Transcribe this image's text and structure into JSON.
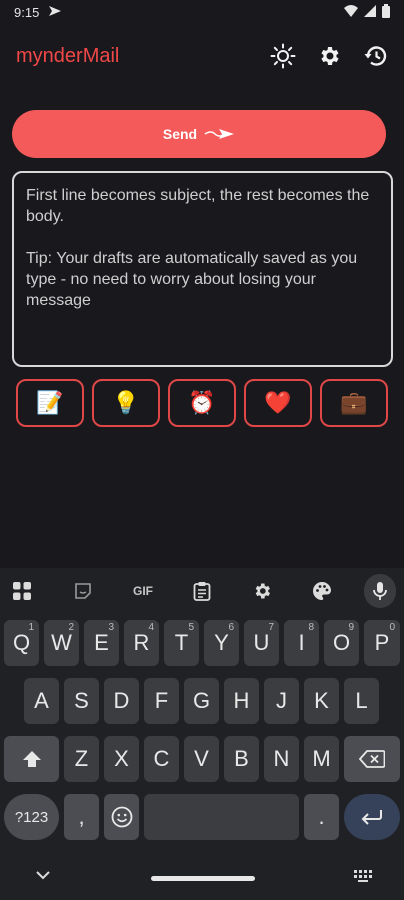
{
  "status": {
    "time": "9:15"
  },
  "app": {
    "title": "mynderMail"
  },
  "send": {
    "label": "Send"
  },
  "compose": {
    "placeholder": "First line becomes subject, the rest becomes the body.\n\nTip: Your drafts are automatically saved as you type - no need to worry about losing your message",
    "value": ""
  },
  "templates": [
    "📝",
    "💡",
    "⏰",
    "❤️",
    "💼"
  ],
  "keyboard": {
    "toolbar": {
      "gif": "GIF"
    },
    "row1": [
      {
        "k": "Q",
        "h": "1"
      },
      {
        "k": "W",
        "h": "2"
      },
      {
        "k": "E",
        "h": "3"
      },
      {
        "k": "R",
        "h": "4"
      },
      {
        "k": "T",
        "h": "5"
      },
      {
        "k": "Y",
        "h": "6"
      },
      {
        "k": "U",
        "h": "7"
      },
      {
        "k": "I",
        "h": "8"
      },
      {
        "k": "O",
        "h": "9"
      },
      {
        "k": "P",
        "h": "0"
      }
    ],
    "row2": [
      "A",
      "S",
      "D",
      "F",
      "G",
      "H",
      "J",
      "K",
      "L"
    ],
    "row3": [
      "Z",
      "X",
      "C",
      "V",
      "B",
      "N",
      "M"
    ],
    "row4": {
      "symbols": "?123",
      "comma": ",",
      "period": "."
    }
  },
  "colors": {
    "accent": "#f45a5a",
    "title": "#f04848",
    "background": "#18181d",
    "keyboard": "#202124"
  }
}
